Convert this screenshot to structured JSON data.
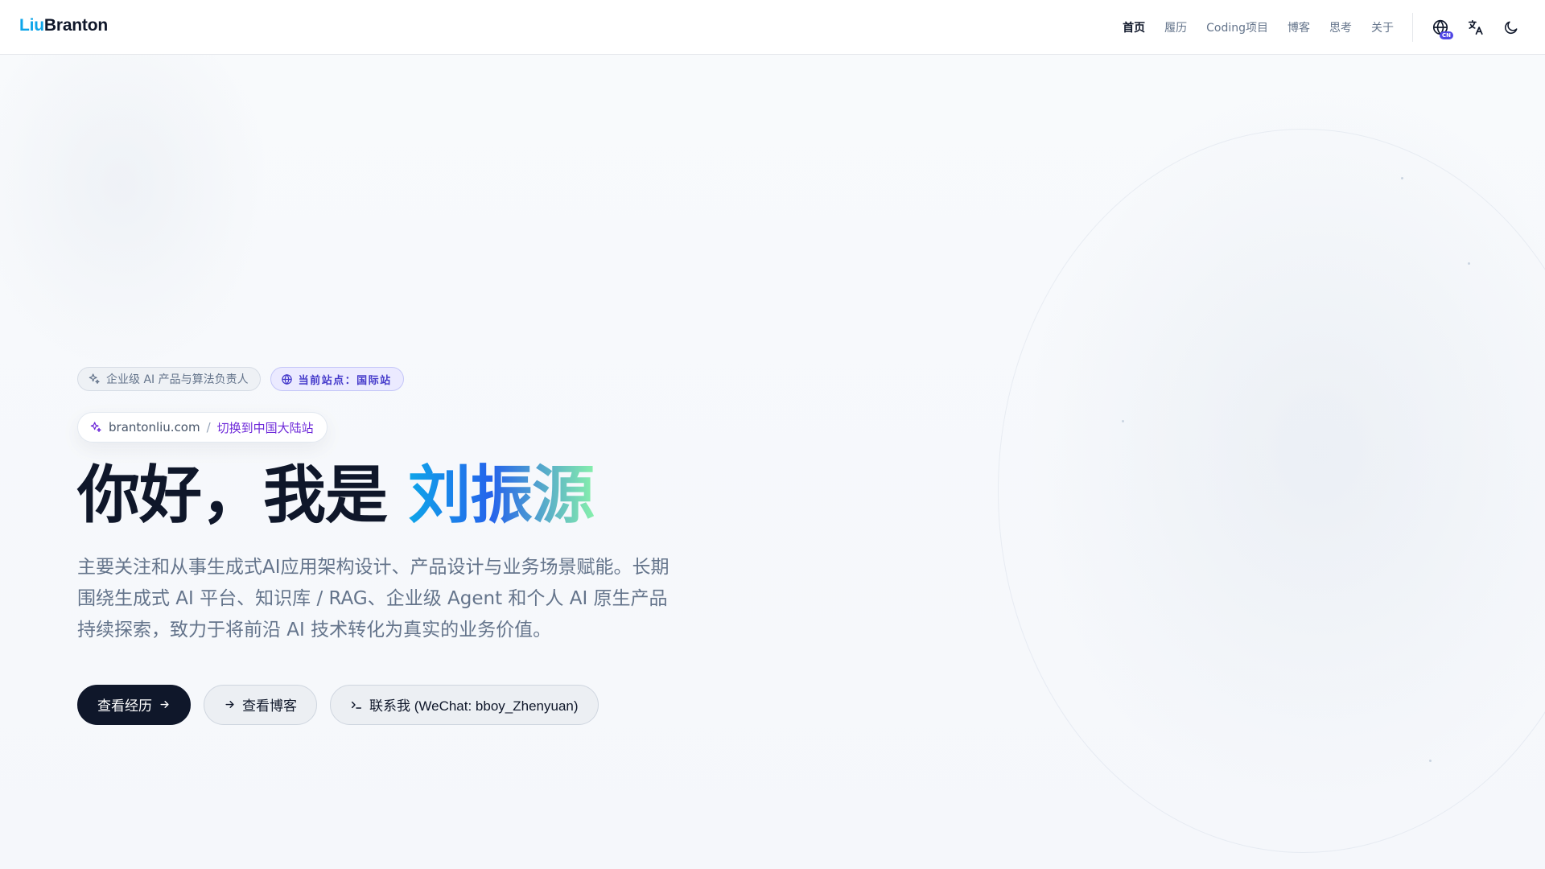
{
  "header": {
    "logo_part1": "Liu",
    "logo_part2": "Branton",
    "nav": [
      {
        "label": "首页",
        "active": true
      },
      {
        "label": "履历",
        "active": false
      },
      {
        "label": "Coding项目",
        "active": false
      },
      {
        "label": "博客",
        "active": false
      },
      {
        "label": "思考",
        "active": false
      },
      {
        "label": "关于",
        "active": false
      }
    ],
    "icons": [
      "globe-region-icon",
      "translate-icon",
      "moon-icon"
    ],
    "region_badge": "CN"
  },
  "hero": {
    "badge_role": "企业级 AI 产品与算法负责人",
    "badge_site": "当前站点：国际站",
    "site_domain": "brantonliu.com",
    "site_separator": "/",
    "site_switch": "切换到中国大陆站",
    "title_prefix": "你好，我是 ",
    "title_name": "刘振源",
    "description_lines": [
      "主要关注和从事生成式AI应用架构设计、产品设计与业务场景赋能。长期",
      "围绕生成式 AI 平台、知识库 / RAG、企业级 Agent 和个人 AI 原生产品",
      "持续探索，致力于将前沿 AI 技术转化为真实的业务价值。"
    ],
    "buttons": {
      "resume": "查看经历",
      "blog": "查看博客",
      "contact": "联系我 (WeChat: bboy_Zhenyuan)"
    }
  },
  "colors": {
    "accent_blue": "#0ea5e9",
    "dark": "#0f172a",
    "purple": "#4338ca",
    "muted": "#64748b"
  }
}
